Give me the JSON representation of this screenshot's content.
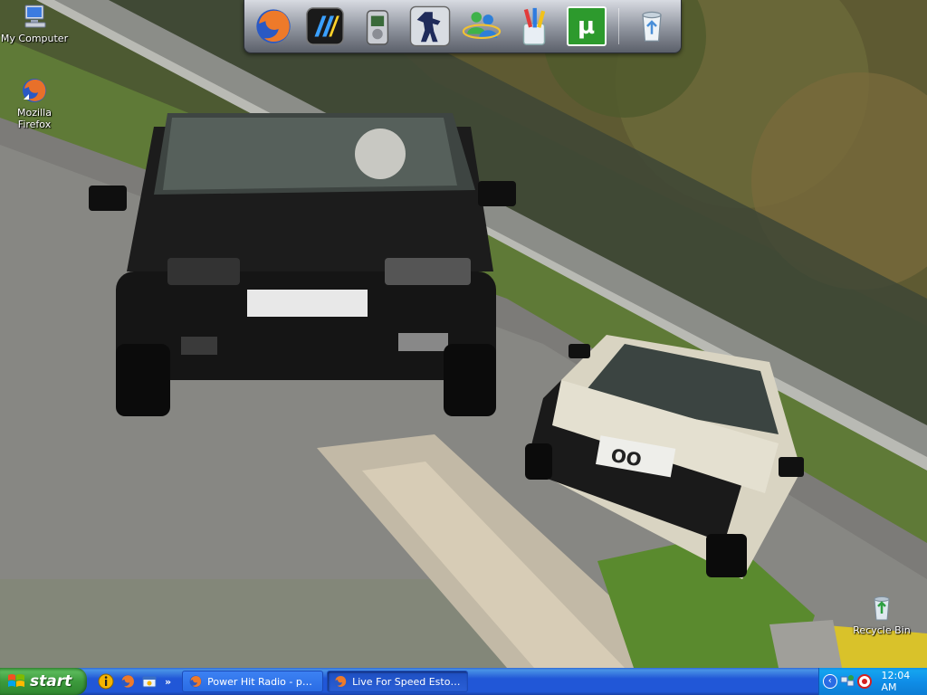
{
  "desktop": {
    "icons": [
      {
        "label": "My Computer",
        "icon": "my-computer-icon"
      },
      {
        "label": "Mozilla Firefox",
        "icon": "firefox-icon"
      },
      {
        "label": "Recycle Bin",
        "icon": "recycle-bin-icon"
      }
    ],
    "wallpaper": {
      "description_icon": "racing-game-wallpaper",
      "plate_text": "OO"
    }
  },
  "dock": {
    "items": [
      {
        "icon": "firefox-icon"
      },
      {
        "icon": "lfs-launcher-icon"
      },
      {
        "icon": "media-player-icon"
      },
      {
        "icon": "counter-strike-icon"
      },
      {
        "icon": "msn-messenger-icon"
      },
      {
        "icon": "paint-tools-icon"
      },
      {
        "icon": "utorrent-icon",
        "glyph": "µ"
      },
      {
        "icon": "recycle-bin-icon"
      }
    ]
  },
  "taskbar": {
    "start_label": "start",
    "quick_launch": [
      {
        "icon": "info-icon"
      },
      {
        "icon": "firefox-icon"
      },
      {
        "icon": "windows-explorer-icon"
      }
    ],
    "quick_launch_more": "»",
    "tasks": [
      {
        "label": "Power Hit Radio - po...",
        "icon": "firefox-icon",
        "active": false
      },
      {
        "label": "Live For Speed Estoni...",
        "icon": "firefox-icon",
        "active": true
      }
    ],
    "tray": {
      "toggle": "‹",
      "icons": [
        {
          "icon": "network-icon"
        },
        {
          "icon": "antivirus-icon"
        }
      ],
      "clock": "12:04 AM"
    }
  },
  "colors": {
    "taskbar_blue": "#2157d7",
    "start_green": "#3c9a3c",
    "tray_blue": "#0f8ee8"
  }
}
